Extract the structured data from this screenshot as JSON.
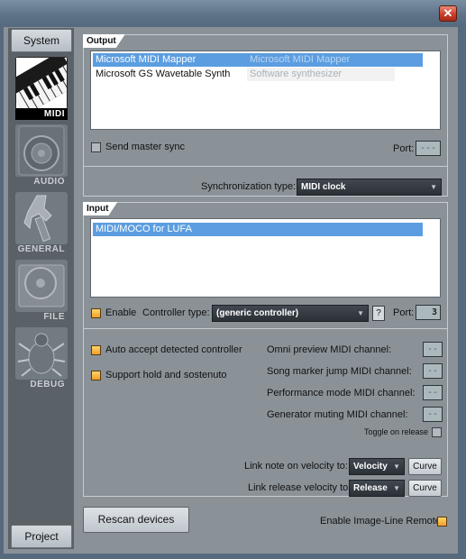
{
  "window": {
    "close_glyph": "✕"
  },
  "sidebar": {
    "system_tab": "System",
    "project_tab": "Project",
    "categories": [
      {
        "label": "MIDI",
        "icon": "piano-keyboard-icon",
        "active": true
      },
      {
        "label": "AUDIO",
        "icon": "speaker-icon",
        "active": false
      },
      {
        "label": "GENERAL",
        "icon": "wrench-icon",
        "active": false
      },
      {
        "label": "FILE",
        "icon": "disc-icon",
        "active": false
      },
      {
        "label": "DEBUG",
        "icon": "bug-icon",
        "active": false
      }
    ]
  },
  "output": {
    "title": "Output",
    "devices": [
      {
        "name": "Microsoft MIDI Mapper",
        "description": "Microsoft MIDI Mapper",
        "selected": true
      },
      {
        "name": "Microsoft GS Wavetable Synth",
        "description": "Software synthesizer",
        "selected": false
      }
    ],
    "send_master_sync_label": "Send master sync",
    "send_master_sync_checked": false,
    "port_label": "Port:",
    "port_value": "---",
    "sync_type_label": "Synchronization type:",
    "sync_type_value": "MIDI clock"
  },
  "input": {
    "title": "Input",
    "devices": [
      {
        "name": "MIDI/MOCO for LUFA",
        "selected": true
      }
    ],
    "enable_label": "Enable",
    "enable_checked": true,
    "controller_type_label": "Controller type:",
    "controller_type_value": "(generic controller)",
    "help_label": "?",
    "port_label": "Port:",
    "port_value": "3",
    "auto_accept_label": "Auto accept detected controller",
    "support_hold_label": "Support hold and sostenuto",
    "omni_preview_label": "Omni preview MIDI channel:",
    "omni_preview_value": "--",
    "song_marker_label": "Song marker jump MIDI channel:",
    "song_marker_value": "--",
    "performance_mode_label": "Performance mode MIDI channel:",
    "performance_mode_value": "--",
    "generator_muting_label": "Generator muting MIDI channel:",
    "generator_muting_value": "--",
    "toggle_on_release_label": "Toggle on release",
    "link_note_label": "Link note on velocity to:",
    "link_note_value": "Velocity",
    "link_release_label": "Link release velocity to:",
    "link_release_value": "Release",
    "curve_label": "Curve"
  },
  "footer": {
    "rescan_label": "Rescan devices",
    "remote_label": "Enable Image-Line Remote",
    "remote_checked": true
  },
  "colors": {
    "selection": "#5b9de0",
    "checkbox_on": "#f0a028",
    "panel_bg": "#8a9298",
    "sidebar_bg": "#5a6167"
  }
}
